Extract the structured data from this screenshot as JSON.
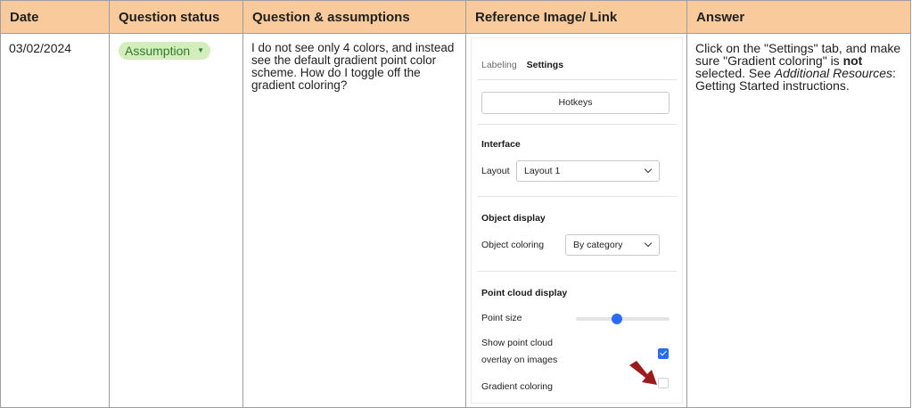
{
  "table": {
    "headers": [
      "Date",
      "Question status",
      "Question & assumptions",
      "Reference Image/ Link",
      "Answer"
    ],
    "row": {
      "date": "03/02/2024",
      "status": "Assumption",
      "question": "I do not see only 4 colors, and instead see the default gradient point color scheme. How do I toggle off the gradient coloring?",
      "answer": {
        "part1": "Click on the \"Settings\" tab, and make sure \"Gradient coloring\" is ",
        "bold": "not",
        "part2": " selected. See ",
        "italic": "Additional Resources",
        "part3": ": Getting Started instructions."
      }
    }
  },
  "reference": {
    "tab_labeling": "Labeling",
    "tab_settings": "Settings",
    "hotkeys": "Hotkeys",
    "interface_title": "Interface",
    "layout_label": "Layout",
    "layout_value": "Layout 1",
    "object_display_title": "Object display",
    "object_coloring_label": "Object coloring",
    "object_coloring_value": "By category",
    "point_cloud_title": "Point cloud display",
    "point_size_label": "Point size",
    "point_size_value": 0.45,
    "overlay_label_1": "Show point cloud",
    "overlay_label_2": "overlay on images",
    "overlay_checked": true,
    "gradient_label": "Gradient coloring",
    "gradient_checked": false
  },
  "colors": {
    "header_bg": "#f9cb9c",
    "chip_bg": "#d4edbc",
    "chip_text": "#2f7a2f",
    "accent_blue": "#2a6cf0",
    "arrow": "#9b1b1b"
  }
}
